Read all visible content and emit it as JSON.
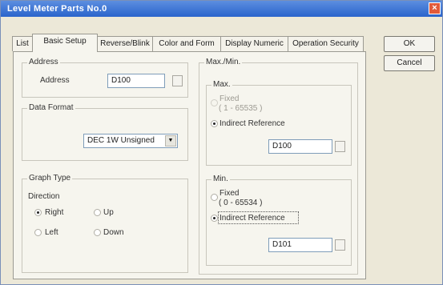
{
  "window": {
    "title": "Level Meter Parts No.0",
    "close": "×"
  },
  "tabs": [
    {
      "label": "List"
    },
    {
      "label": "Basic Setup"
    },
    {
      "label": "Reverse/Blink"
    },
    {
      "label": "Color and Form"
    },
    {
      "label": "Display Numeric"
    },
    {
      "label": "Operation Security"
    }
  ],
  "buttons": {
    "ok": "OK",
    "cancel": "Cancel"
  },
  "address": {
    "group": "Address",
    "label": "Address",
    "value": "D100"
  },
  "data_format": {
    "group": "Data Format",
    "selected": "DEC 1W Unsigned"
  },
  "graph_type": {
    "group": "Graph Type",
    "direction_label": "Direction",
    "right": "Right",
    "up": "Up",
    "left": "Left",
    "down": "Down",
    "selected": "Right"
  },
  "maxmin": {
    "group": "Max./Min.",
    "max": {
      "group": "Max.",
      "fixed_label": "Fixed",
      "fixed_range": "( 1 - 65535 )",
      "indirect_label": "Indirect Reference",
      "value": "D100",
      "selected": "Indirect Reference"
    },
    "min": {
      "group": "Min.",
      "fixed_label": "Fixed",
      "fixed_range": "( 0 - 65534 )",
      "indirect_label": "Indirect Reference",
      "value": "D101",
      "selected": "Indirect Reference"
    }
  }
}
